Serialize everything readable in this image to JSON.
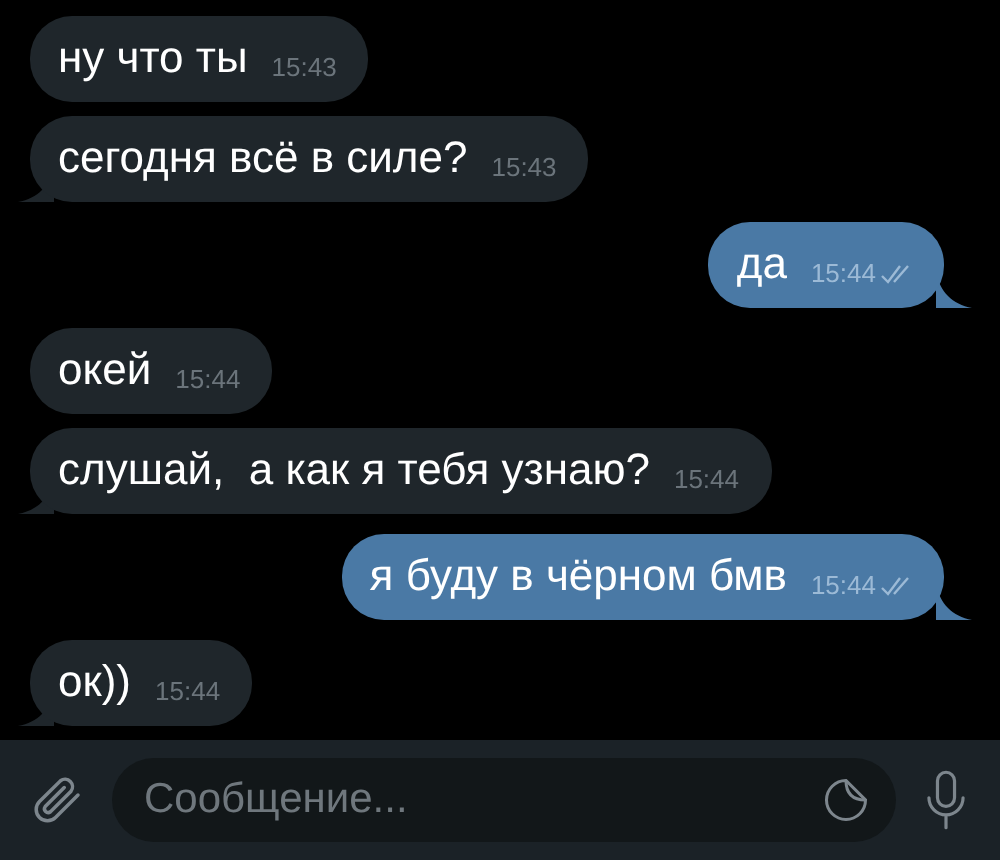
{
  "messages": [
    {
      "kind": "incoming",
      "text": "ну что ты",
      "time": "15:43",
      "tail": false
    },
    {
      "kind": "incoming",
      "text": "сегодня всё в силе?",
      "time": "15:43",
      "tail": true
    },
    {
      "kind": "outgoing",
      "text": "да",
      "time": "15:44",
      "tail": true,
      "read": true
    },
    {
      "kind": "incoming",
      "text": "окей",
      "time": "15:44",
      "tail": false
    },
    {
      "kind": "incoming",
      "text": "слушай,  а как я тебя узнаю?",
      "time": "15:44",
      "tail": true
    },
    {
      "kind": "outgoing",
      "text": "я буду в чёрном бмв",
      "time": "15:44",
      "tail": true,
      "read": true
    },
    {
      "kind": "incoming",
      "text": "ок))",
      "time": "15:44",
      "tail": true
    }
  ],
  "composer": {
    "placeholder": "Сообщение..."
  }
}
